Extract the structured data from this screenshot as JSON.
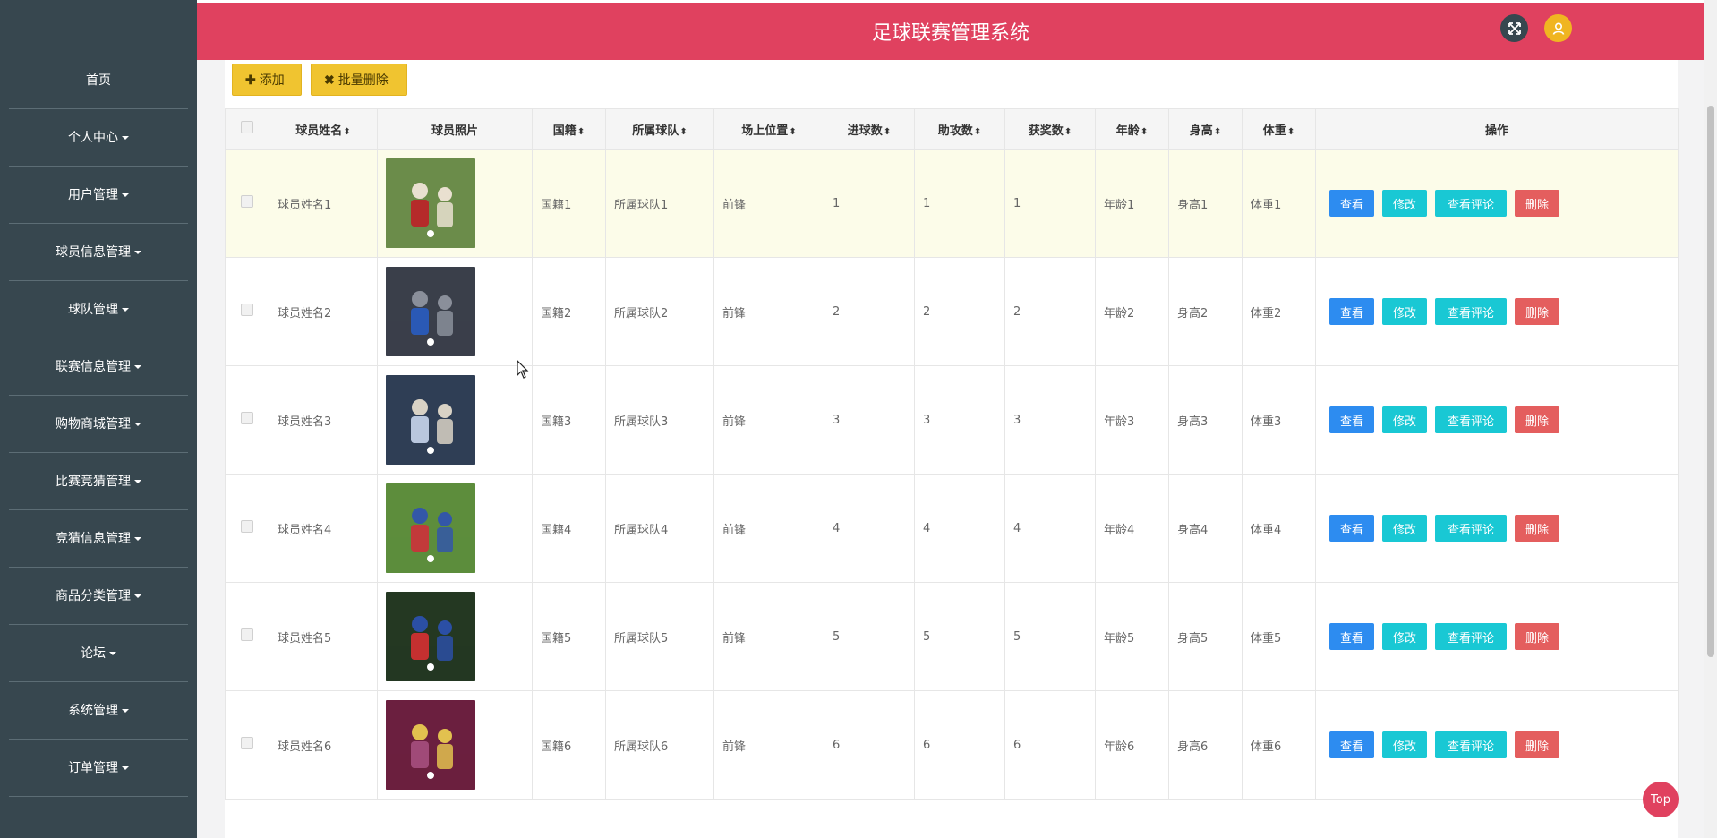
{
  "header": {
    "title": "足球联赛管理系统"
  },
  "sidebar": {
    "items": [
      {
        "label": "首页",
        "has_caret": false
      },
      {
        "label": "个人中心",
        "has_caret": true
      },
      {
        "label": "用户管理",
        "has_caret": true
      },
      {
        "label": "球员信息管理",
        "has_caret": true
      },
      {
        "label": "球队管理",
        "has_caret": true
      },
      {
        "label": "联赛信息管理",
        "has_caret": true
      },
      {
        "label": "购物商城管理",
        "has_caret": true
      },
      {
        "label": "比赛竞猜管理",
        "has_caret": true
      },
      {
        "label": "竞猜信息管理",
        "has_caret": true
      },
      {
        "label": "商品分类管理",
        "has_caret": true
      },
      {
        "label": "论坛",
        "has_caret": true
      },
      {
        "label": "系统管理",
        "has_caret": true
      },
      {
        "label": "订单管理",
        "has_caret": true
      }
    ]
  },
  "toolbar": {
    "add_label": "添加",
    "batch_delete_label": "批量删除"
  },
  "table": {
    "columns": {
      "name": "球员姓名",
      "photo": "球员照片",
      "nationality": "国籍",
      "team": "所属球队",
      "position": "场上位置",
      "goals": "进球数",
      "assists": "助攻数",
      "awards": "获奖数",
      "age": "年龄",
      "height": "身高",
      "weight": "体重",
      "actions": "操作"
    },
    "row_actions": {
      "view": "查看",
      "edit": "修改",
      "comments": "查看评论",
      "delete": "删除"
    },
    "rows": [
      {
        "name": "球员姓名1",
        "nationality": "国籍1",
        "team": "所属球队1",
        "position": "前锋",
        "goals": "1",
        "assists": "1",
        "awards": "1",
        "age": "年龄1",
        "height": "身高1",
        "weight": "体重1"
      },
      {
        "name": "球员姓名2",
        "nationality": "国籍2",
        "team": "所属球队2",
        "position": "前锋",
        "goals": "2",
        "assists": "2",
        "awards": "2",
        "age": "年龄2",
        "height": "身高2",
        "weight": "体重2"
      },
      {
        "name": "球员姓名3",
        "nationality": "国籍3",
        "team": "所属球队3",
        "position": "前锋",
        "goals": "3",
        "assists": "3",
        "awards": "3",
        "age": "年龄3",
        "height": "身高3",
        "weight": "体重3"
      },
      {
        "name": "球员姓名4",
        "nationality": "国籍4",
        "team": "所属球队4",
        "position": "前锋",
        "goals": "4",
        "assists": "4",
        "awards": "4",
        "age": "年龄4",
        "height": "身高4",
        "weight": "体重4"
      },
      {
        "name": "球员姓名5",
        "nationality": "国籍5",
        "team": "所属球队5",
        "position": "前锋",
        "goals": "5",
        "assists": "5",
        "awards": "5",
        "age": "年龄5",
        "height": "身高5",
        "weight": "体重5"
      },
      {
        "name": "球员姓名6",
        "nationality": "国籍6",
        "team": "所属球队6",
        "position": "前锋",
        "goals": "6",
        "assists": "6",
        "awards": "6",
        "age": "年龄6",
        "height": "身高6",
        "weight": "体重6"
      }
    ]
  },
  "back_to_top": "Top",
  "colors": {
    "header": "#e0415f",
    "sidebar": "#37474f",
    "add_button": "#f0c430",
    "view_button": "#2d8cf0",
    "edit_button": "#19c8d4",
    "delete_button": "#e45e5e",
    "row_highlight": "#fcfce9"
  },
  "icons": {
    "fullscreen": "expand-arrows-icon",
    "user": "user-icon",
    "add": "plus-icon",
    "batch_delete": "x-icon",
    "sort": "sort-icon",
    "mouse": "mouse-cursor-icon"
  }
}
